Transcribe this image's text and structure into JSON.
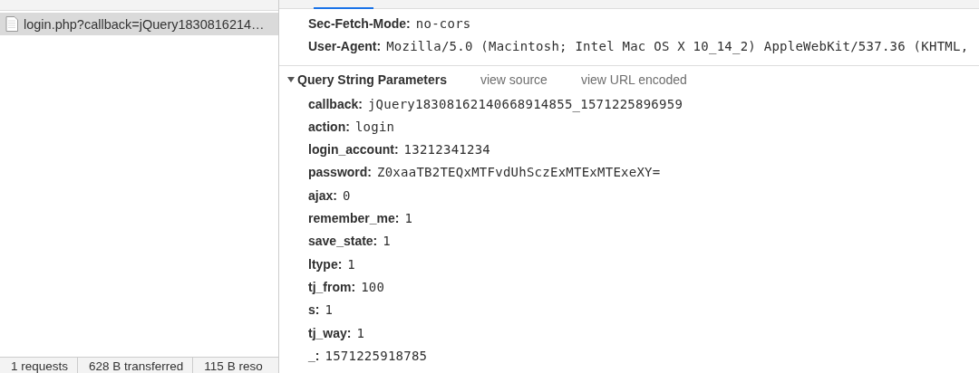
{
  "request_list": {
    "items": [
      {
        "name": "login.php?callback=jQuery1830816214…",
        "selected": true
      }
    ]
  },
  "status_bar": [
    "1 requests",
    "628 B transferred",
    "115 B reso"
  ],
  "headers": [
    {
      "key": "Sec-Fetch-Mode:",
      "value": "no-cors"
    },
    {
      "key": "User-Agent:",
      "value": "Mozilla/5.0 (Macintosh; Intel Mac OS X 10_14_2) AppleWebKit/537.36 (KHTML,"
    }
  ],
  "query_string_parameters": {
    "title": "Query String Parameters",
    "expanded": true,
    "actions": [
      "view source",
      "view URL encoded"
    ],
    "params": [
      {
        "key": "callback:",
        "value": "jQuery18308162140668914855_1571225896959"
      },
      {
        "key": "action:",
        "value": "login"
      },
      {
        "key": "login_account:",
        "value": "13212341234"
      },
      {
        "key": "password:",
        "value": "Z0xaaTB2TEQxMTFvdUhSczExMTExMTExeXY="
      },
      {
        "key": "ajax:",
        "value": "0"
      },
      {
        "key": "remember_me:",
        "value": "1"
      },
      {
        "key": "save_state:",
        "value": "1"
      },
      {
        "key": "ltype:",
        "value": "1"
      },
      {
        "key": "tj_from:",
        "value": "100"
      },
      {
        "key": "s:",
        "value": "1"
      },
      {
        "key": "tj_way:",
        "value": "1"
      },
      {
        "key": "_:",
        "value": "1571225918785"
      }
    ]
  }
}
